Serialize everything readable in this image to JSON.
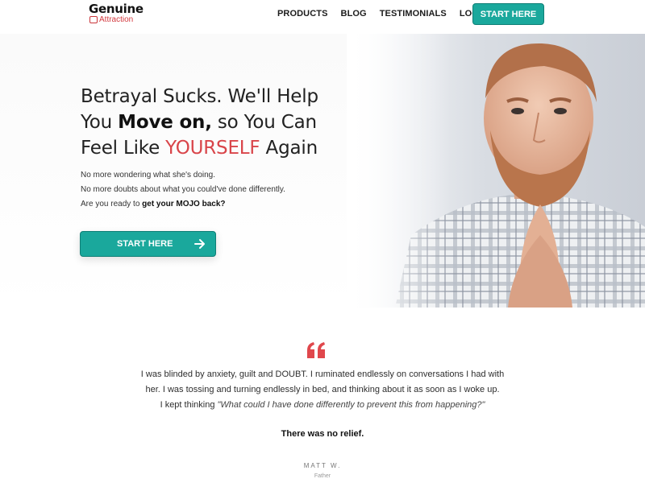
{
  "header": {
    "logo_top": "Genuine",
    "logo_sub": "Attraction",
    "nav": [
      "PRODUCTS",
      "BLOG",
      "TESTIMONIALS",
      "LOGIN"
    ],
    "cta_label": "START HERE"
  },
  "hero": {
    "title_part1": "Betrayal Sucks. We'll Help You ",
    "title_bold": "Move on,",
    "title_part2": " so You Can Feel Like ",
    "title_accent": "YOURSELF",
    "title_part3": " Again",
    "line1": "No more wondering what she's doing.",
    "line2": "No more doubts about what you could've done differently.",
    "line3_prefix": "Are you ready to ",
    "line3_bold": "get your MOJO back?",
    "cta_label": "START HERE",
    "accent_color": "#d9454a",
    "button_color": "#1aa89c"
  },
  "testimonial": {
    "line1": "I was blinded by anxiety, guilt and DOUBT. I ruminated endlessly on conversations I had with",
    "line2": "her. I was tossing and turning endlessly in bed, and thinking about it as soon as I woke up.",
    "line3_prefix": "I kept thinking ",
    "line3_italic": "\"What could I have done differently to prevent this from happening?\"",
    "relief": "There was no relief.",
    "author": "MATT W.",
    "role": "Father"
  }
}
